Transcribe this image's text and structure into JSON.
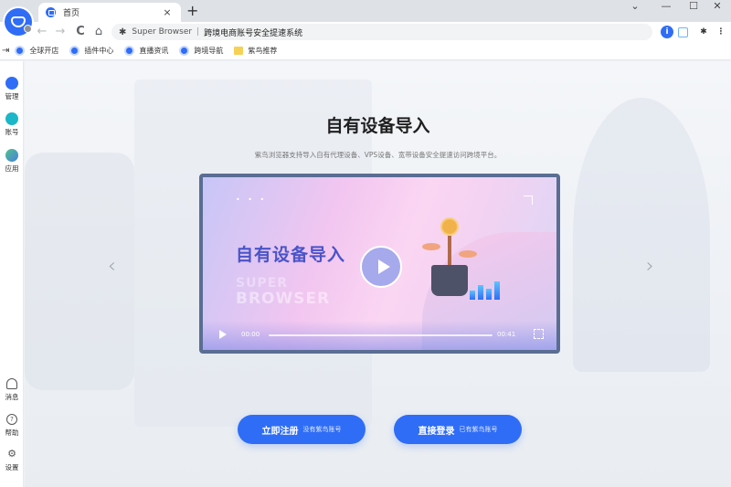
{
  "browser": {
    "tab": {
      "title": "首页",
      "close": "×"
    },
    "new_tab": "+",
    "window_controls": {
      "dropdown": "⌄",
      "minimize": "—",
      "maximize": "☐",
      "close": "✕"
    },
    "nav": {
      "back": "←",
      "forward": "→",
      "reload": "C",
      "home": "⌂"
    },
    "address": {
      "site_name": "Super Browser",
      "separator": "|",
      "title": "跨境电商账号安全提速系统"
    },
    "toolbar_icons": [
      "info-icon",
      "translate-icon",
      "extensions-icon",
      "menu-icon"
    ],
    "menu_dots": "⋮"
  },
  "bookmarks": [
    {
      "label": "全球开店",
      "type": "site"
    },
    {
      "label": "插件中心",
      "type": "site"
    },
    {
      "label": "直播资讯",
      "type": "site"
    },
    {
      "label": "跨境导航",
      "type": "site"
    },
    {
      "label": "紫鸟推荐",
      "type": "folder"
    }
  ],
  "sidebar": {
    "top": [
      {
        "label": "管理",
        "icon": "manage-icon",
        "color": "#2f6df6"
      },
      {
        "label": "账号",
        "icon": "account-icon",
        "color": "#1bb7c8"
      },
      {
        "label": "应用",
        "icon": "apps-icon",
        "color": "#4a7fe0"
      }
    ],
    "bottom": [
      {
        "label": "消息",
        "icon": "bell-icon",
        "glyph": "♫"
      },
      {
        "label": "帮助",
        "icon": "help-icon",
        "glyph": "?"
      },
      {
        "label": "设置",
        "icon": "gear-icon",
        "glyph": "⚙"
      }
    ]
  },
  "main": {
    "title": "自有设备导入",
    "subtitle": "紫鸟浏览器支持导入自有代理设备、VPS设备、宽带设备安全提速访问跨境平台。",
    "prev_arrow": "‹",
    "next_arrow": "›",
    "video": {
      "title": "自有设备导入",
      "watermark_line1": "SUPER",
      "watermark_line2": "BROWSER",
      "dots": "• • •",
      "current_time": "00:00",
      "duration": "00:41",
      "progress": 0
    },
    "buttons": [
      {
        "label": "立即注册",
        "hint": "没有紫鸟账号"
      },
      {
        "label": "直接登录",
        "hint": "已有紫鸟账号"
      }
    ]
  },
  "colors": {
    "accent": "#2f6df6",
    "video_frame": "#5a6d93",
    "video_title": "#4a54c8"
  }
}
